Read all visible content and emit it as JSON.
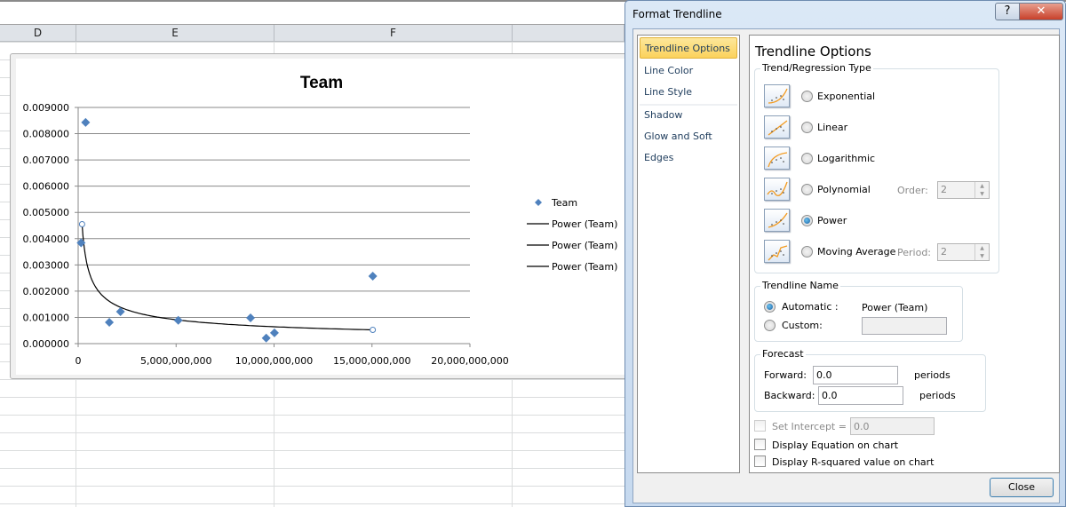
{
  "spreadsheet": {
    "columns": [
      "D",
      "E",
      "F"
    ]
  },
  "chart_data": {
    "type": "scatter",
    "title": "Team",
    "xlabel": "",
    "ylabel": "",
    "xlim": [
      0,
      20000000000
    ],
    "ylim": [
      0,
      0.009
    ],
    "x_ticks": [
      "0",
      "5,000,000,000",
      "10,000,000,000",
      "15,000,000,000",
      "20,000,000,000"
    ],
    "y_ticks": [
      "0.000000",
      "0.001000",
      "0.002000",
      "0.003000",
      "0.004000",
      "0.005000",
      "0.006000",
      "0.007000",
      "0.008000",
      "0.009000"
    ],
    "grid": "horizontal",
    "legend_position": "right",
    "series": [
      {
        "name": "Team",
        "type": "scatter",
        "color": "#4f81bd",
        "x": [
          380000000,
          150000000,
          1590000000,
          2160000000,
          5110000000,
          8800000000,
          9600000000,
          10020000000,
          15040000000
        ],
        "y": [
          0.00843,
          0.00384,
          0.00081,
          0.00122,
          0.00089,
          0.00098,
          0.00021,
          0.00041,
          0.00257
        ]
      },
      {
        "name": "Power (Team)",
        "type": "power-trendline",
        "color": "#000000",
        "coef_a_at_x0": 0.00455,
        "x0": 200000000,
        "exponent": -0.5,
        "x_range": [
          200000000,
          15040000000
        ]
      }
    ],
    "legend": [
      "Team",
      "Power (Team)",
      "Power (Team)",
      "Power (Team)"
    ]
  },
  "dialog": {
    "title": "Format Trendline",
    "help": "?",
    "close_x": "✕",
    "nav": [
      "Trendline Options",
      "Line Color",
      "Line Style",
      "Shadow",
      "Glow and Soft Edges"
    ],
    "panel_title": "Trendline Options",
    "regression_group": "Trend/Regression Type",
    "types": [
      "Exponential",
      "Linear",
      "Logarithmic",
      "Polynomial",
      "Power",
      "Moving Average"
    ],
    "selected_type": "Power",
    "order_label": "Order:",
    "order_value": "2",
    "period_label": "Period:",
    "period_value": "2",
    "name_group": "Trendline Name",
    "automatic_label": "Automatic :",
    "automatic_value": "Power (Team)",
    "custom_label": "Custom:",
    "custom_value": "",
    "forecast_group": "Forecast",
    "forward_label": "Forward:",
    "forward_value": "0.0",
    "backward_label": "Backward:",
    "backward_value": "0.0",
    "periods": "periods",
    "set_intercept_label": "Set Intercept =",
    "intercept_value": "0.0",
    "display_equation": "Display Equation on chart",
    "display_r2": "Display R-squared value on chart",
    "close_button": "Close"
  }
}
